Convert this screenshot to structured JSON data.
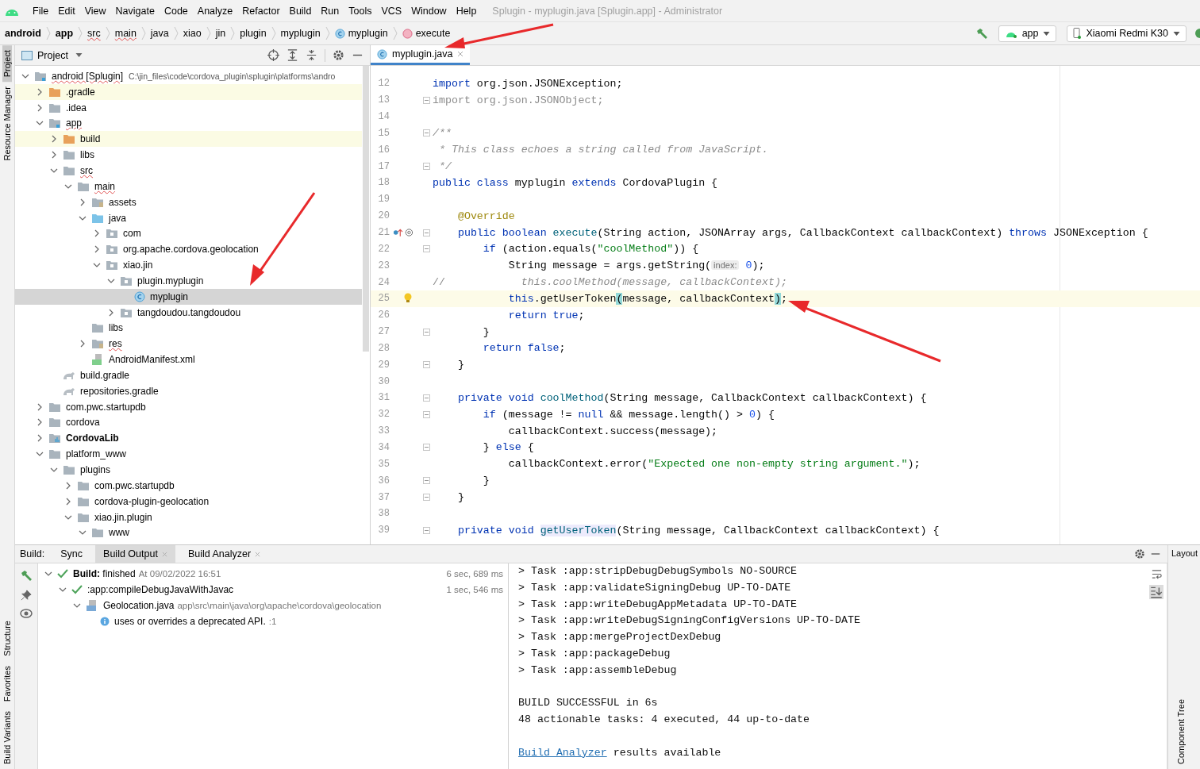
{
  "window": {
    "title": "Splugin - myplugin.java [Splugin.app] - Administrator"
  },
  "menu": [
    "File",
    "Edit",
    "View",
    "Navigate",
    "Code",
    "Analyze",
    "Refactor",
    "Build",
    "Run",
    "Tools",
    "VCS",
    "Window",
    "Help"
  ],
  "breadcrumbs": [
    {
      "label": "android",
      "bold": true,
      "typo": false
    },
    {
      "label": "app",
      "bold": true,
      "typo": false
    },
    {
      "label": "src",
      "bold": false,
      "typo": true
    },
    {
      "label": "main",
      "bold": false,
      "typo": true
    },
    {
      "label": "java",
      "bold": false,
      "typo": false
    },
    {
      "label": "xiao",
      "bold": false,
      "typo": false
    },
    {
      "label": "jin",
      "bold": false,
      "typo": false
    },
    {
      "label": "plugin",
      "bold": false,
      "typo": false
    },
    {
      "label": "myplugin",
      "bold": false,
      "typo": false
    },
    {
      "label": "myplugin",
      "kind": "class",
      "bold": false,
      "typo": false
    },
    {
      "label": "execute",
      "kind": "method",
      "bold": false,
      "typo": false
    }
  ],
  "run_config": {
    "module": "app",
    "device": "Xiaomi Redmi K30"
  },
  "left_tool_windows": [
    {
      "label": "Project",
      "selected": true
    },
    {
      "label": "Resource Manager",
      "selected": false
    }
  ],
  "left_tool_windows_bottom": [
    {
      "label": "Structure",
      "selected": false
    },
    {
      "label": "Favorites",
      "selected": false
    },
    {
      "label": "Build Variants",
      "selected": false
    }
  ],
  "project_panel": {
    "title": "Project"
  },
  "project_tree": {
    "items": [
      {
        "label": "android [Splugin]",
        "detail": "C:\\jin_files\\code\\cordova_plugin\\splugin\\platforms\\andro",
        "kind": "module",
        "expanded": true,
        "selected": false,
        "typo": true,
        "children": [
          {
            "label": ".gradle",
            "kind": "folder",
            "expanded": false,
            "selected": false,
            "excluded": true
          },
          {
            "label": ".idea",
            "kind": "folder",
            "expanded": false,
            "selected": false
          },
          {
            "label": "app",
            "kind": "module",
            "expanded": true,
            "selected": false,
            "typo": true,
            "children": [
              {
                "label": "build",
                "kind": "folder",
                "expanded": false,
                "selected": false,
                "excluded": true
              },
              {
                "label": "libs",
                "kind": "folder",
                "expanded": false,
                "selected": false
              },
              {
                "label": "src",
                "kind": "folder",
                "expanded": true,
                "selected": false,
                "typo": true,
                "children": [
                  {
                    "label": "main",
                    "kind": "folder",
                    "expanded": true,
                    "selected": false,
                    "typo": true,
                    "children": [
                      {
                        "label": "assets",
                        "kind": "resfolder",
                        "expanded": false,
                        "selected": false
                      },
                      {
                        "label": "java",
                        "kind": "src",
                        "expanded": true,
                        "selected": false,
                        "children": [
                          {
                            "label": "com",
                            "kind": "package",
                            "expanded": false,
                            "selected": false
                          },
                          {
                            "label": "org.apache.cordova.geolocation",
                            "kind": "package",
                            "expanded": false,
                            "selected": false
                          },
                          {
                            "label": "xiao.jin",
                            "kind": "package",
                            "expanded": true,
                            "selected": false,
                            "children": [
                              {
                                "label": "plugin.myplugin",
                                "kind": "package",
                                "expanded": true,
                                "selected": false,
                                "children": [
                                  {
                                    "label": "myplugin",
                                    "kind": "class",
                                    "selected": true
                                  }
                                ]
                              },
                              {
                                "label": "tangdoudou.tangdoudou",
                                "kind": "package",
                                "expanded": false,
                                "selected": false
                              }
                            ]
                          }
                        ]
                      },
                      {
                        "label": "libs",
                        "kind": "folder",
                        "selected": false
                      },
                      {
                        "label": "res",
                        "kind": "resfolder",
                        "expanded": false,
                        "selected": false,
                        "typo": true
                      },
                      {
                        "label": "AndroidManifest.xml",
                        "kind": "manifest",
                        "selected": false
                      }
                    ]
                  }
                ]
              },
              {
                "label": "build.gradle",
                "kind": "gradle",
                "selected": false
              },
              {
                "label": "repositories.gradle",
                "kind": "gradle",
                "selected": false
              }
            ]
          },
          {
            "label": "com.pwc.startupdb",
            "kind": "folder",
            "expanded": false,
            "selected": false
          },
          {
            "label": "cordova",
            "kind": "folder",
            "expanded": false,
            "selected": false
          },
          {
            "label": "CordovaLib",
            "kind": "library",
            "expanded": false,
            "selected": false,
            "bold": true
          },
          {
            "label": "platform_www",
            "kind": "folder",
            "expanded": true,
            "selected": false,
            "children": [
              {
                "label": "plugins",
                "kind": "folder",
                "expanded": true,
                "selected": false,
                "children": [
                  {
                    "label": "com.pwc.startupdb",
                    "kind": "folder",
                    "expanded": false,
                    "selected": false
                  },
                  {
                    "label": "cordova-plugin-geolocation",
                    "kind": "folder",
                    "expanded": false,
                    "selected": false
                  },
                  {
                    "label": "xiao.jin.plugin",
                    "kind": "folder",
                    "expanded": true,
                    "selected": false,
                    "children": [
                      {
                        "label": "www",
                        "kind": "folder",
                        "expanded": true,
                        "selected": false
                      }
                    ]
                  }
                ]
              }
            ]
          }
        ]
      }
    ]
  },
  "editor": {
    "tabs": [
      {
        "label": "myplugin.java",
        "selected": true
      }
    ],
    "lines": [
      {
        "no": "12",
        "tokens": [
          {
            "text": "import",
            "kind": "kw"
          },
          {
            "text": " org.json.JSONException;"
          }
        ]
      },
      {
        "no": "13",
        "fold": true,
        "tokens": [
          {
            "text": "import org.json.JSONObject;",
            "kind": "dim"
          }
        ]
      },
      {
        "no": "14"
      },
      {
        "no": "15",
        "fold": true,
        "tokens": [
          {
            "text": "/**",
            "kind": "cmt"
          }
        ]
      },
      {
        "no": "16",
        "tokens": [
          {
            "text": " * This class echoes a string called from JavaScript.",
            "kind": "cmt"
          }
        ]
      },
      {
        "no": "17",
        "fold": true,
        "tokens": [
          {
            "text": " */",
            "kind": "cmt"
          }
        ]
      },
      {
        "no": "18",
        "tokens": [
          {
            "text": "public class",
            "kind": "kw"
          },
          {
            "text": " myplugin "
          },
          {
            "text": "extends",
            "kind": "kw"
          },
          {
            "text": " CordovaPlugin {"
          }
        ]
      },
      {
        "no": "19"
      },
      {
        "no": "20",
        "tokens": [
          {
            "text": "    @Override",
            "kind": "ann"
          }
        ]
      },
      {
        "no": "21",
        "fold": true,
        "kind": "override",
        "tokens": [
          {
            "text": "    public boolean ",
            "kind": "kw"
          },
          {
            "text": "execute",
            "kind": "fn"
          },
          {
            "text": "(String action, JSONArray args, CallbackContext callbackContext) "
          },
          {
            "text": "throws",
            "kind": "kw"
          },
          {
            "text": " JSONException {"
          }
        ]
      },
      {
        "no": "22",
        "fold": true,
        "tokens": [
          {
            "text": "        if",
            "kind": "kw"
          },
          {
            "text": " (action.equals("
          },
          {
            "text": "\"coolMethod\"",
            "kind": "str"
          },
          {
            "text": ")) {"
          }
        ]
      },
      {
        "no": "23",
        "tokens": [
          {
            "text": "            String message = args.getString("
          },
          {
            "text": "index:",
            "kind": "hint"
          },
          {
            "text": " 0",
            "kind": "num"
          },
          {
            "text": ");"
          }
        ]
      },
      {
        "no": "24",
        "tokens": [
          {
            "text": "//",
            "kind": "dim"
          },
          {
            "text": "            this.coolMethod(message, callbackContext);",
            "kind": "cmt"
          }
        ]
      },
      {
        "no": "25",
        "current": true,
        "kind": "bulb",
        "tokens": [
          {
            "text": "            this",
            "kind": "kw"
          },
          {
            "text": ".getUserToken"
          },
          {
            "text": "(",
            "kind": "brace"
          },
          {
            "text": "message, callbackContext"
          },
          {
            "text": ")",
            "kind": "brace"
          },
          {
            "text": ";"
          }
        ]
      },
      {
        "no": "26",
        "tokens": [
          {
            "text": "            return true",
            "kind": "kw"
          },
          {
            "text": ";"
          }
        ]
      },
      {
        "no": "27",
        "fold": true,
        "tokens": [
          {
            "text": "        }"
          }
        ]
      },
      {
        "no": "28",
        "tokens": [
          {
            "text": "        return false",
            "kind": "kw"
          },
          {
            "text": ";"
          }
        ]
      },
      {
        "no": "29",
        "fold": true,
        "tokens": [
          {
            "text": "    }"
          }
        ]
      },
      {
        "no": "30"
      },
      {
        "no": "31",
        "fold": true,
        "tokens": [
          {
            "text": "    private void ",
            "kind": "kw"
          },
          {
            "text": "coolMethod",
            "kind": "fn"
          },
          {
            "text": "(String message, CallbackContext callbackContext) {"
          }
        ]
      },
      {
        "no": "32",
        "fold": true,
        "tokens": [
          {
            "text": "        if",
            "kind": "kw"
          },
          {
            "text": " (message != "
          },
          {
            "text": "null",
            "kind": "kw"
          },
          {
            "text": " && message.length() > "
          },
          {
            "text": "0",
            "kind": "num"
          },
          {
            "text": ") {"
          }
        ]
      },
      {
        "no": "33",
        "tokens": [
          {
            "text": "            callbackContext.success(message);"
          }
        ]
      },
      {
        "no": "34",
        "fold": true,
        "tokens": [
          {
            "text": "        } "
          },
          {
            "text": "else",
            "kind": "kw"
          },
          {
            "text": " {"
          }
        ]
      },
      {
        "no": "35",
        "tokens": [
          {
            "text": "            callbackContext.error("
          },
          {
            "text": "\"Expected one non-empty string argument.\"",
            "kind": "str"
          },
          {
            "text": ");"
          }
        ]
      },
      {
        "no": "36",
        "fold": true,
        "tokens": [
          {
            "text": "        }"
          }
        ]
      },
      {
        "no": "37",
        "fold": true,
        "tokens": [
          {
            "text": "    }"
          }
        ]
      },
      {
        "no": "38"
      },
      {
        "no": "39",
        "fold": true,
        "tokens": [
          {
            "text": "    private void ",
            "kind": "kw"
          },
          {
            "text": "getUserToken",
            "kind": "fnhl"
          },
          {
            "text": "(String message, CallbackContext callbackContext) {"
          }
        ]
      }
    ]
  },
  "build_panel": {
    "title": "Build:",
    "tabs": [
      {
        "label": "Sync",
        "selected": false
      },
      {
        "label": "Build Output",
        "selected": true
      },
      {
        "label": "Build Analyzer",
        "selected": false
      }
    ],
    "tree": [
      {
        "text": "**Build:** finished",
        "detail": "At 09/02/2022 16:51",
        "time": "6 sec, 689 ms",
        "kind": "check",
        "expanded": true,
        "children": [
          {
            "text": ":app:compileDebugJavaWithJavac",
            "time": "1 sec, 546 ms",
            "kind": "check",
            "expanded": true,
            "children": [
              {
                "text": "Geolocation.java",
                "detail": "app\\src\\main\\java\\org\\apache\\cordova\\geolocation",
                "kind": "file",
                "expanded": true,
                "children": [
                  {
                    "text": "uses or overrides a deprecated API.",
                    "detail": ":1",
                    "kind": "info"
                  }
                ]
              }
            ]
          }
        ]
      }
    ],
    "console": [
      {
        "kind": "text",
        "text": "> Task :app:stripDebugDebugSymbols NO-SOURCE"
      },
      {
        "kind": "text",
        "text": "> Task :app:validateSigningDebug UP-TO-DATE"
      },
      {
        "kind": "text",
        "text": "> Task :app:writeDebugAppMetadata UP-TO-DATE"
      },
      {
        "kind": "text",
        "text": "> Task :app:writeDebugSigningConfigVersions UP-TO-DATE"
      },
      {
        "kind": "text",
        "text": "> Task :app:mergeProjectDexDebug"
      },
      {
        "kind": "text",
        "text": "> Task :app:packageDebug"
      },
      {
        "kind": "text",
        "text": "> Task :app:assembleDebug"
      },
      {
        "kind": "gap"
      },
      {
        "kind": "text",
        "text": "BUILD SUCCESSFUL in 6s"
      },
      {
        "kind": "text",
        "text": "48 actionable tasks: 4 executed, 44 up-to-date"
      },
      {
        "kind": "gap"
      },
      {
        "kind": "link",
        "link": "Build Analyzer",
        "text": " results available"
      }
    ]
  },
  "right_tool_windows": [
    {
      "label": "Layout",
      "selected": false
    },
    {
      "label": "Component Tree",
      "selected": false
    }
  ]
}
